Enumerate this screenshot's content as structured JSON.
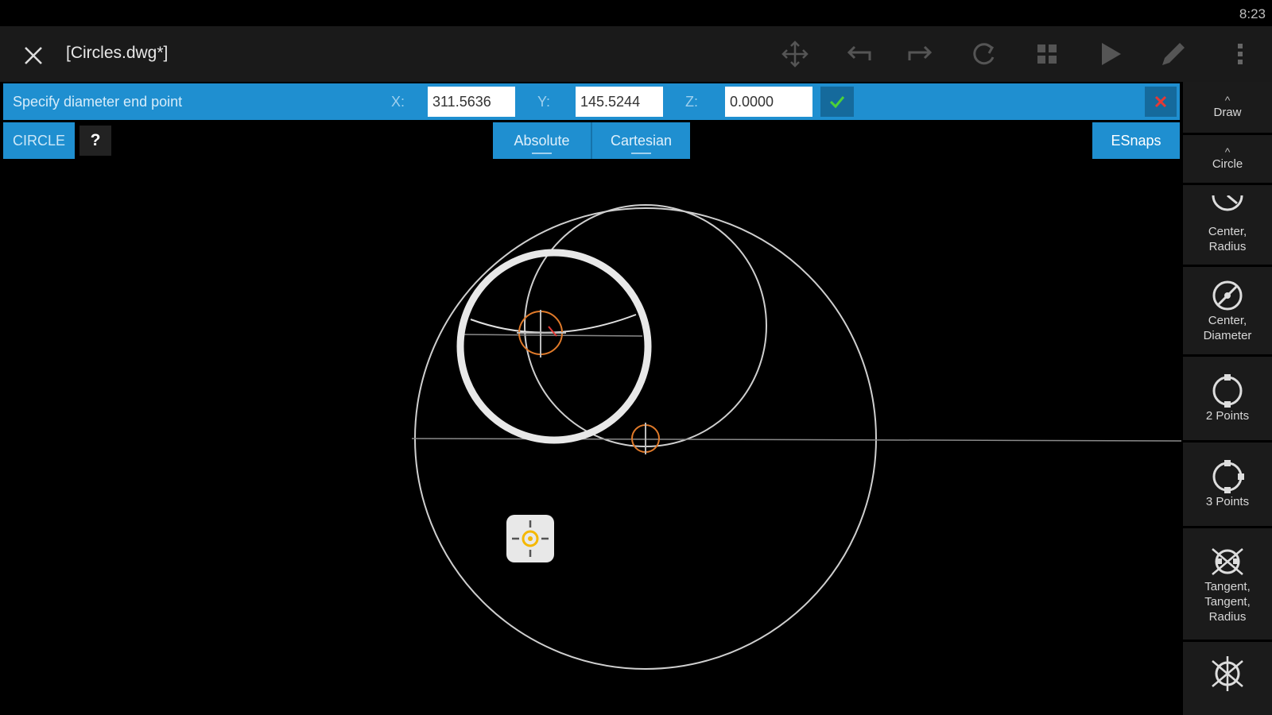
{
  "status": {
    "time": "8:23"
  },
  "toolbar": {
    "title": "[Circles.dwg*]",
    "icons": [
      "close-icon",
      "pan-icon",
      "undo-icon",
      "redo-icon",
      "rotate-icon",
      "grid-icon",
      "play-icon",
      "pencil-icon",
      "overflow-menu-icon"
    ]
  },
  "prompt": {
    "text": "Specify diameter end point",
    "x_label": "X:",
    "y_label": "Y:",
    "z_label": "Z:",
    "x_value": "311.5636",
    "y_value": "145.5244",
    "z_value": "0.0000"
  },
  "command": {
    "label": "CIRCLE",
    "help_label": "?"
  },
  "modes": {
    "absolute": "Absolute",
    "cartesian": "Cartesian"
  },
  "esnaps_label": "ESnaps",
  "side_panel": {
    "draw": "Draw",
    "circle": "Circle",
    "center_radius": "Center,\nRadius",
    "center_diameter": "Center,\nDiameter",
    "two_points": "2 Points",
    "three_points": "3 Points",
    "ttr": "Tangent,\nTangent,\nRadius"
  },
  "colors": {
    "accent_blue": "#1f8fd0",
    "panel_dark": "#1b1b1b",
    "snap_orange": "#e07a2a",
    "crosshair_yellow": "#f5b800"
  }
}
